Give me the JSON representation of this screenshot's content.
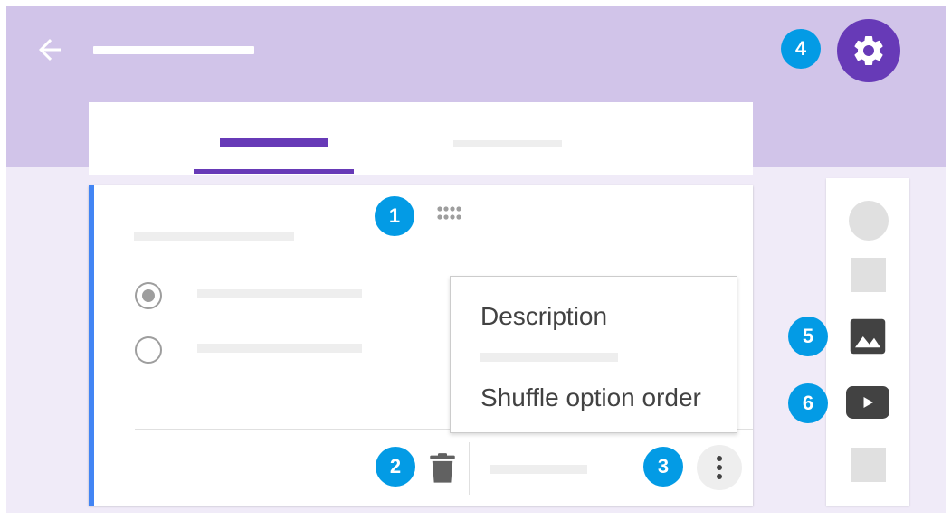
{
  "header": {
    "back_icon": "arrow-left-icon",
    "settings_icon": "gear-icon"
  },
  "badges": {
    "drag_handle": "1",
    "delete": "2",
    "more": "3",
    "settings": "4",
    "add_image": "5",
    "add_video": "6"
  },
  "question": {
    "options_icon": "radio-button-icon",
    "delete_icon": "trash-icon",
    "more_icon": "more-vertical-icon"
  },
  "menu": {
    "items": [
      "Description",
      "Shuffle option order"
    ]
  },
  "toolbar": {
    "icons": [
      "add-circle-icon",
      "title-icon",
      "image-icon",
      "video-icon",
      "section-icon"
    ]
  },
  "colors": {
    "accent": "#673ab7",
    "header_bg": "#d1c4e9",
    "page_bg": "#f0ebf8",
    "badge": "#039be5",
    "question_highlight": "#4285f4"
  }
}
